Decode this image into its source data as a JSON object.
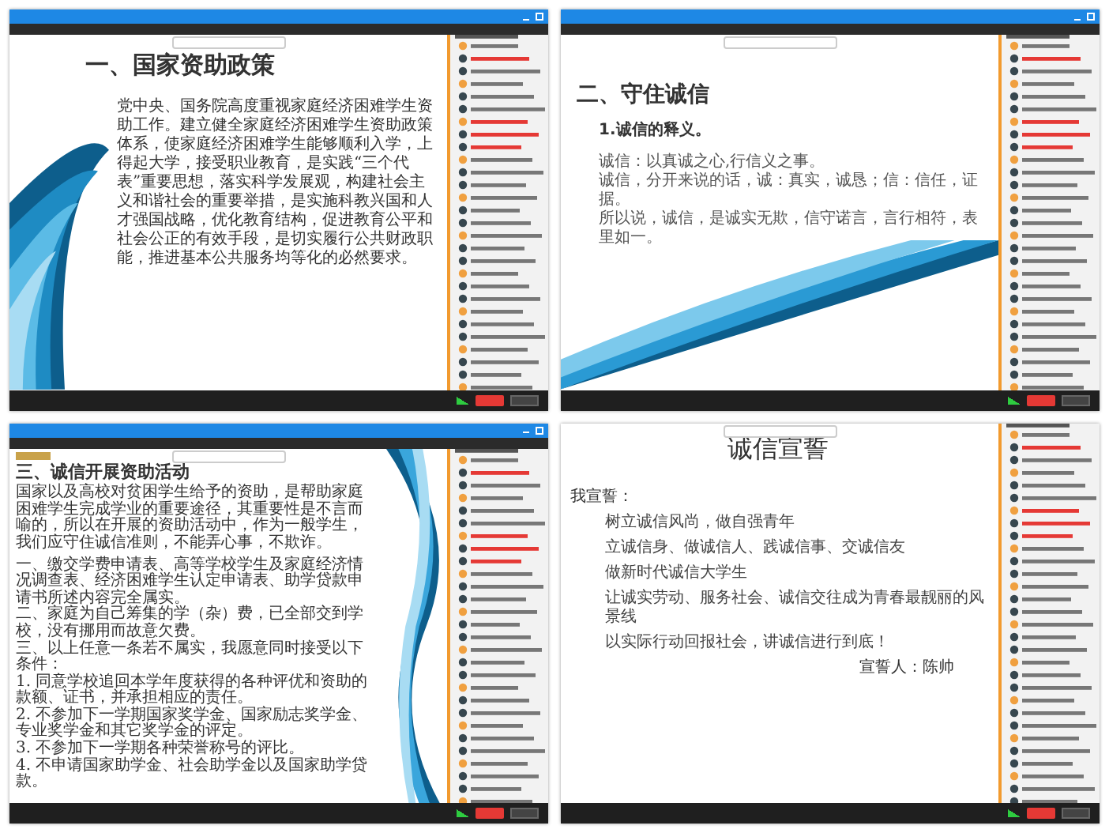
{
  "panels": [
    {
      "kind": "policy",
      "title_bar": true,
      "title": "一、国家资助政策",
      "body": "党中央、国务院高度重视家庭经济困难学生资助工作。建立健全家庭经济困难学生资助政策体系，使家庭经济困难学生能够顺利入学，上得起大学，接受职业教育，是实践“三个代表”重要思想，落实科学发展观，构建社会主义和谐社会的重要举措，是实施科教兴国和人才强国战略，优化教育结构，促进教育公平和社会公正的有效手段，是切实履行公共财政职能，推进基本公共服务均等化的必然要求。"
    },
    {
      "kind": "definition",
      "title_bar": true,
      "title": "二、守住诚信",
      "subtitle": "1.诚信的释义。",
      "lines": [
        "诚信：以真诚之心,行信义之事。",
        "诚信，分开来说的话，诚：真实，诚恳；信：信任，证据。",
        "所以说，诚信，是诚实无欺，信守诺言，言行相符，表里如一。"
      ]
    },
    {
      "kind": "activity",
      "title_bar": true,
      "title": "三、诚信开展资助活动",
      "body": "国家以及高校对贫困学生给予的资助，是帮助家庭困难学生完成学业的重要途径，其重要性是不言而喻的，所以在开展的资助活动中，作为一般学生，我们应守住诚信准则，不能弄心事，不欺诈。",
      "items": [
        "一、缴交学费申请表、高等学校学生及家庭经济情况调查表、经济困难学生认定申请表、助学贷款申请书所述内容完全属实。",
        "二、家庭为自己筹集的学（杂）费，已全部交到学校，没有挪用而故意欠费。",
        "三、以上任意一条若不属实，我愿意同时接受以下条件：",
        "1. 同意学校追回本学年度获得的各种评优和资助的款额、证书，并承担相应的责任。",
        "2. 不参加下一学期国家奖学金、国家励志奖学金、专业奖学金和其它奖学金的评定。",
        "3. 不参加下一学期各种荣誉称号的评比。",
        "4. 不申请国家助学金、社会助学金以及国家助学贷款。"
      ]
    },
    {
      "kind": "oath",
      "title_bar": false,
      "title": "诚信宣誓",
      "intro": "我宣誓：",
      "lines": [
        "树立诚信风尚，做自强青年",
        "立诚信身、做诚信人、践诚信事、交诚信友",
        "做新时代诚信大学生",
        "让诚实劳动、服务社会、诚信交往成为青春最靓丽的风景线",
        "以实际行动回报社会，讲诚信进行到底！"
      ],
      "signer": "宣誓人：陈帅"
    }
  ]
}
